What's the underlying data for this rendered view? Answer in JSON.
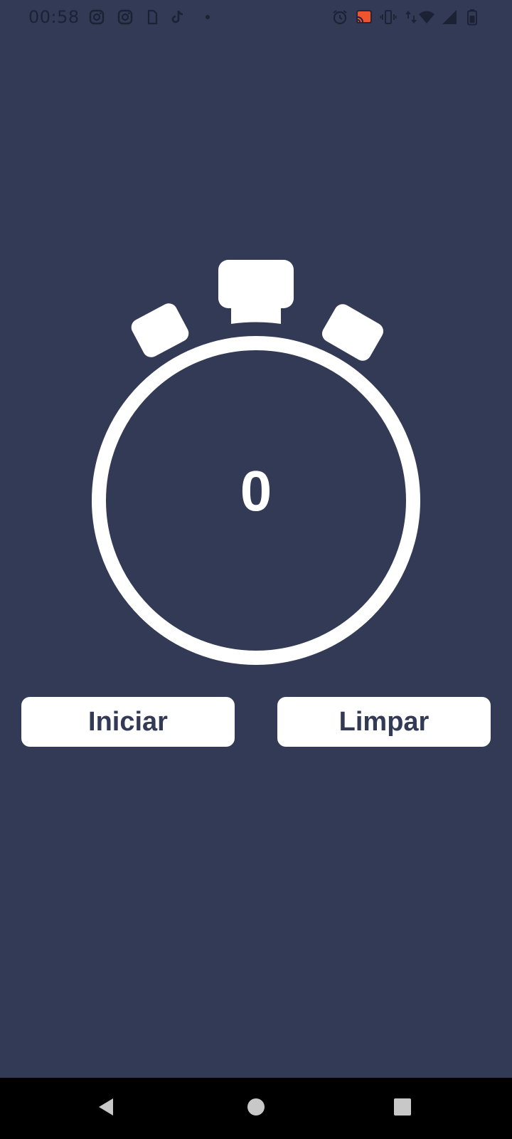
{
  "status_bar": {
    "time": "00:58",
    "left_icons": [
      "instagram-icon",
      "instagram-icon",
      "sim-card-icon",
      "tiktok-icon",
      "dot-icon"
    ],
    "right_icons": [
      "alarm-icon",
      "cast-icon",
      "vibrate-icon",
      "data-arrows-icon",
      "wifi-icon",
      "signal-icon",
      "battery-icon"
    ]
  },
  "timer": {
    "value": "0"
  },
  "buttons": {
    "start_label": "Iniciar",
    "clear_label": "Limpar"
  },
  "nav": {
    "icons": [
      "back-icon",
      "home-icon",
      "recent-apps-icon"
    ]
  },
  "colors": {
    "background": "#323a55",
    "foreground": "#ffffff",
    "status_icons": "#1c2236",
    "cast_accent": "#f0542d"
  }
}
